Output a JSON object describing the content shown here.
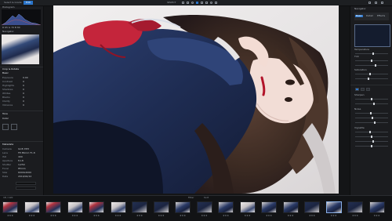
{
  "topbar": {
    "tabs": [
      "Select & Grade",
      "Edit"
    ],
    "active_tab_index": 1,
    "center_label": "SELECT",
    "icons": [
      "grid-icon",
      "compare-icon",
      "zoom-icon",
      "rotate-icon",
      "crop-icon",
      "brush-icon",
      "heal-icon",
      "info-icon"
    ]
  },
  "left_panel": {
    "histogram_label": "Histogram",
    "histogram_values": "R 65  G 70  B 80",
    "navigator_label": "Navigator",
    "sections": [
      {
        "label": "Crop & Rotate"
      },
      {
        "label": "Basic"
      },
      {
        "label": "Tone"
      },
      {
        "label": "Color"
      }
    ],
    "rows": [
      {
        "k": "Exposure",
        "v": "0.00"
      },
      {
        "k": "Contrast",
        "v": "0"
      },
      {
        "k": "Highlights",
        "v": "0"
      },
      {
        "k": "Shadows",
        "v": "0"
      },
      {
        "k": "Whites",
        "v": "0"
      },
      {
        "k": "Blacks",
        "v": "0"
      },
      {
        "k": "Clarity",
        "v": "0"
      },
      {
        "k": "Vibrance",
        "v": "0"
      }
    ],
    "meta_label": "Metadata",
    "meta_rows": [
      {
        "k": "Camera",
        "v": "ILCE-7M3"
      },
      {
        "k": "Lens",
        "v": "FE 85mm F1.8"
      },
      {
        "k": "ISO",
        "v": "400"
      },
      {
        "k": "Aperture",
        "v": "f/1.8"
      },
      {
        "k": "Shutter",
        "v": "1/250"
      },
      {
        "k": "Focal",
        "v": "85mm"
      },
      {
        "k": "Size",
        "v": "6000x4000"
      },
      {
        "k": "Date",
        "v": "2019/04/12"
      }
    ]
  },
  "viewer": {
    "image_description": "photo-viewer"
  },
  "right_panel": {
    "header": "Navigator",
    "tabs": [
      "Basic",
      "Detail",
      "Effects"
    ],
    "panel_labels": [
      "Temperature",
      "Tint",
      "Saturation",
      "Sharpen",
      "Noise",
      "Vignette"
    ],
    "slider_levels": [
      0.55,
      0.5,
      0.62,
      0.45,
      0.4,
      0.5,
      0.58,
      0.48,
      0.52,
      0.6,
      0.44,
      0.5,
      0.56,
      0.5
    ]
  },
  "filmstrip": {
    "left_label": "18 / 120",
    "center_label": "Filter",
    "right_label": "Sort",
    "thumbs": [
      "red",
      "light",
      "red",
      "light",
      "red",
      "light",
      "dark",
      "dark",
      "blue",
      "dark",
      "blue",
      "light",
      "blue",
      "blue",
      "dark",
      "blue",
      "dark",
      "blue"
    ],
    "selected_index": 15,
    "stars": "★★★"
  }
}
